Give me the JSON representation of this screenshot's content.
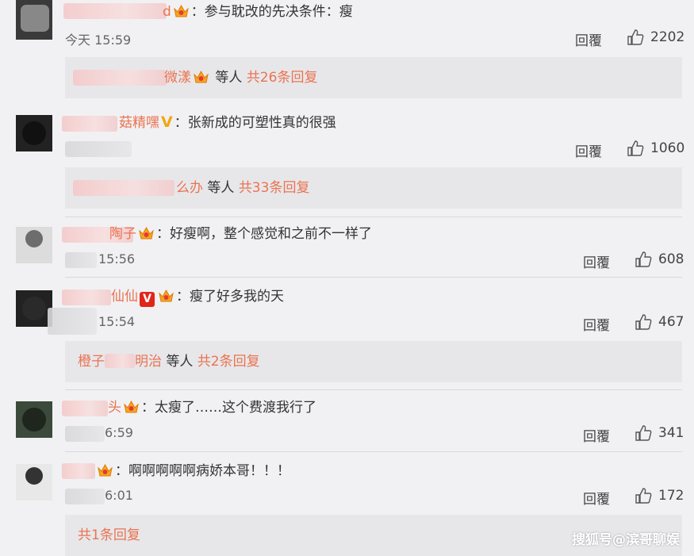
{
  "comments": [
    {
      "username": "d",
      "badge": "vip-crown-icon",
      "text": "：参与耽改的先决条件：瘦",
      "time": "今天 15:59",
      "reply_label": "回覆",
      "likes": "2202",
      "subreply": {
        "user": "微漾",
        "suffix": "等人",
        "count": "共26条回复"
      }
    },
    {
      "username": "菇精嘿",
      "badge": "yellow-v-icon",
      "text": "：张新成的可塑性真的很强",
      "time": "",
      "reply_label": "回覆",
      "likes": "1060",
      "subreply": {
        "user": "么办",
        "suffix": "等人",
        "count": "共33条回复"
      }
    },
    {
      "username": "陶子",
      "badge": "vip-crown-icon",
      "text": "：好瘦啊，整个感觉和之前不一样了",
      "time": "15:56",
      "reply_label": "回覆",
      "likes": "608"
    },
    {
      "username": "仙仙",
      "badge": "red-v-icon",
      "text": "：瘦了好多我的天",
      "time": "15:54",
      "reply_label": "回覆",
      "likes": "467",
      "subreply": {
        "user": "橙子",
        "user2": "明治",
        "suffix": "等人",
        "count": "共2条回复"
      }
    },
    {
      "username": "头",
      "badge": "vip-crown-icon",
      "text": "：太瘦了……这个费渡我行了",
      "time": "6:59",
      "reply_label": "回覆",
      "likes": "341"
    },
    {
      "username": "",
      "badge": "vip-crown-icon",
      "text": "：啊啊啊啊啊病娇本哥！！！",
      "time": "6:01",
      "reply_label": "回覆",
      "likes": "172",
      "subreply": {
        "count": "共1条回复"
      }
    }
  ],
  "watermark": "搜狐号@滨哥聊娱",
  "colors": {
    "username": "#eb7350",
    "background": "#f1f1f3",
    "subreply_bg": "#e7e7ea"
  }
}
